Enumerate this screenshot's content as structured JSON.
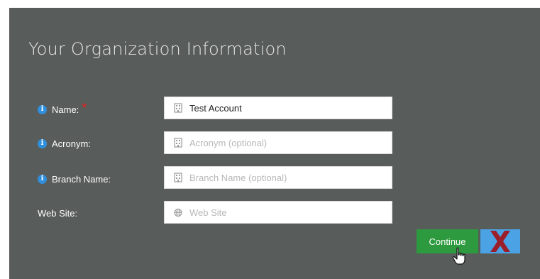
{
  "form": {
    "title": "Your Organization Information",
    "fields": [
      {
        "label": "Name:",
        "required": true,
        "value": "Test Account",
        "placeholder": "",
        "icon": "building-icon",
        "info_icon": true
      },
      {
        "label": "Acronym:",
        "required": false,
        "value": "",
        "placeholder": "Acronym (optional)",
        "icon": "building-icon",
        "info_icon": true
      },
      {
        "label": "Branch Name:",
        "required": false,
        "value": "",
        "placeholder": "Branch Name (optional)",
        "icon": "building-icon",
        "info_icon": true
      },
      {
        "label": "Web Site:",
        "required": false,
        "value": "",
        "placeholder": "Web Site",
        "icon": "globe-icon",
        "info_icon": false
      }
    ],
    "required_marker": "*"
  },
  "actions": {
    "continue_label": "Continue",
    "close_icon": "close-x-icon"
  },
  "colors": {
    "panel_bg": "#585c5b",
    "continue_bg": "#2e9a3f",
    "close_bg": "#4ba3e6",
    "close_x": "#9a1f2a",
    "info_icon": "#2f8fdc",
    "required": "#e2231a"
  }
}
